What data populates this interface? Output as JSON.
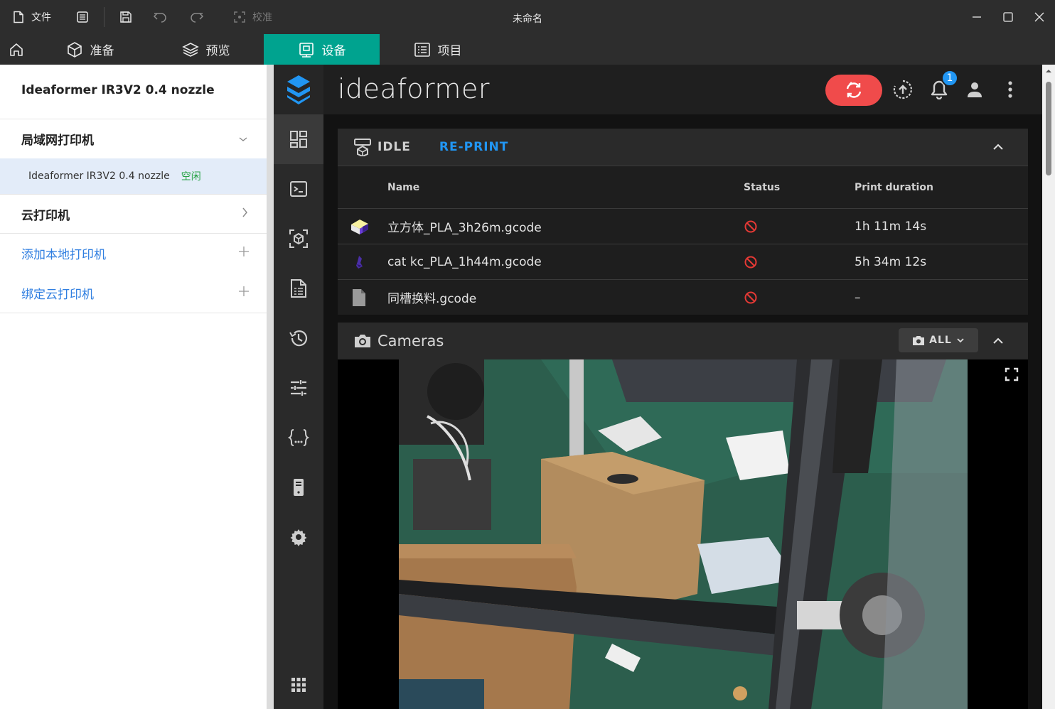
{
  "titlebar": {
    "file_label": "文件",
    "calibrate_label": "校准",
    "window_title": "未命名"
  },
  "navbar": {
    "tabs": [
      {
        "label": "准备",
        "icon": "cube-icon"
      },
      {
        "label": "预览",
        "icon": "layers-icon"
      },
      {
        "label": "设备",
        "icon": "device-icon",
        "active": true
      },
      {
        "label": "项目",
        "icon": "list-icon"
      }
    ]
  },
  "left_panel": {
    "printer_title": "Ideaformer IR3V2 0.4 nozzle",
    "lan_section": "局域网打印机",
    "lan_printer": {
      "name": "Ideaformer IR3V2 0.4 nozzle",
      "status": "空闲"
    },
    "cloud_section": "云打印机",
    "add_local": "添加本地打印机",
    "bind_cloud": "绑定云打印机"
  },
  "app": {
    "brand": "ideaformer",
    "notification_count": "1"
  },
  "status_card": {
    "state": "IDLE",
    "reprint": "RE-PRINT",
    "columns": [
      "Name",
      "Status",
      "Print duration"
    ],
    "rows": [
      {
        "name": "立方体_PLA_3h26m.gcode",
        "duration": "1h 11m 14s",
        "thumb": "cube-thumb"
      },
      {
        "name": "cat kc_PLA_1h44m.gcode",
        "duration": "5h 34m 12s",
        "thumb": "cat-thumb"
      },
      {
        "name": "同槽换料.gcode",
        "duration": "–",
        "thumb": "file-icon"
      }
    ]
  },
  "cameras_card": {
    "title": "Cameras",
    "filter": "ALL"
  },
  "colors": {
    "accent_teal": "#00a38f",
    "brand_blue": "#2196f3",
    "restart_red": "#f04b4b",
    "status_error": "#e53935",
    "status_idle_green": "#25a244"
  }
}
